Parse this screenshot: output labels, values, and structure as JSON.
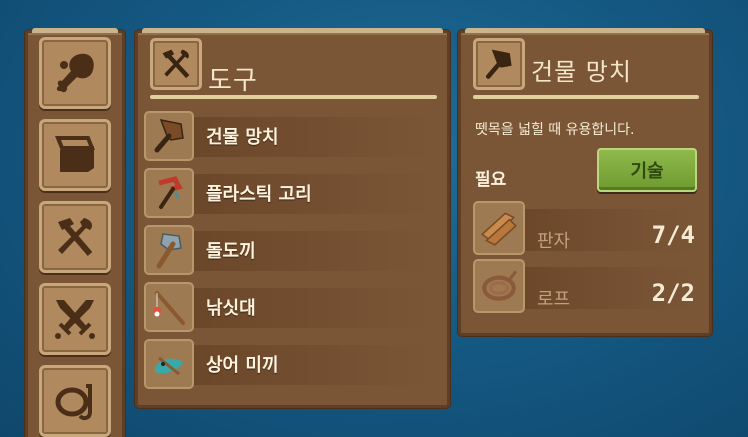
{
  "sidebar": {
    "categories": [
      {
        "icon": "meat-drumstick-icon"
      },
      {
        "icon": "storage-box-icon"
      },
      {
        "icon": "tools-hammer-shovel-icon"
      },
      {
        "icon": "crossed-swords-icon"
      },
      {
        "icon": "snorkel-mask-icon"
      }
    ]
  },
  "tools_panel": {
    "title": "도구",
    "title_icon": "hammer-axe-icon",
    "items": [
      {
        "label": "건물 망치",
        "icon": "building-hammer-icon"
      },
      {
        "label": "플라스틱 고리",
        "icon": "plastic-hook-icon"
      },
      {
        "label": "돌도끼",
        "icon": "stone-axe-icon"
      },
      {
        "label": "낚싯대",
        "icon": "fishing-rod-icon"
      },
      {
        "label": "상어 미끼",
        "icon": "shark-bait-icon"
      }
    ]
  },
  "detail_panel": {
    "title": "건물 망치",
    "icon": "building-hammer-icon",
    "description": "뗏목을 넓힐 때 유용합니다.",
    "requirements_label": "필요",
    "craft_button": "기술",
    "requirements": [
      {
        "name": "판자",
        "count": "7/4",
        "icon": "planks-icon"
      },
      {
        "name": "로프",
        "count": "2/2",
        "icon": "rope-icon"
      }
    ]
  },
  "colors": {
    "panel": "#7a5637",
    "craft_button": "#7fa83e",
    "ocean": "#155a84"
  }
}
